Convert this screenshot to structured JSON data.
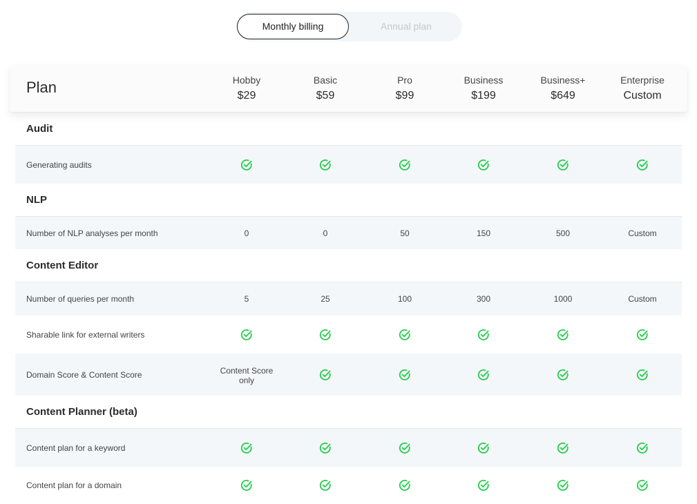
{
  "billing_toggle": {
    "options": [
      "Monthly billing",
      "Annual plan"
    ],
    "selected": "Monthly billing"
  },
  "header": {
    "title": "Plan",
    "plans": [
      {
        "name": "Hobby",
        "price": "$29"
      },
      {
        "name": "Basic",
        "price": "$59"
      },
      {
        "name": "Pro",
        "price": "$99"
      },
      {
        "name": "Business",
        "price": "$199"
      },
      {
        "name": "Business+",
        "price": "$649"
      },
      {
        "name": "Enterprise",
        "price": "Custom"
      }
    ]
  },
  "sections": [
    {
      "title": "Audit",
      "rows": [
        {
          "label": "Generating audits",
          "values": [
            "check",
            "check",
            "check",
            "check",
            "check",
            "check"
          ]
        }
      ]
    },
    {
      "title": "NLP",
      "rows": [
        {
          "label": "Number of NLP analyses per month",
          "values": [
            "0",
            "0",
            "50",
            "150",
            "500",
            "Custom"
          ]
        }
      ]
    },
    {
      "title": "Content Editor",
      "rows": [
        {
          "label": "Number of queries per month",
          "values": [
            "5",
            "25",
            "100",
            "300",
            "1000",
            "Custom"
          ]
        },
        {
          "label": "Sharable link for external writers",
          "values": [
            "check",
            "check",
            "check",
            "check",
            "check",
            "check"
          ]
        },
        {
          "label": "Domain Score & Content Score",
          "values": [
            "Content Score only",
            "check",
            "check",
            "check",
            "check",
            "check"
          ]
        }
      ]
    },
    {
      "title": "Content Planner (beta)",
      "rows": [
        {
          "label": "Content plan for a keyword",
          "values": [
            "check",
            "check",
            "check",
            "check",
            "check",
            "check"
          ]
        },
        {
          "label": "Content plan for a domain",
          "values": [
            "check",
            "check",
            "check",
            "check",
            "check",
            "check"
          ]
        }
      ]
    }
  ],
  "icons": {
    "included": "check-circle-icon"
  },
  "colors": {
    "check": "#22cc4a",
    "row_shade": "#f3f7f9",
    "toggle_bg": "#f2f6f9"
  }
}
